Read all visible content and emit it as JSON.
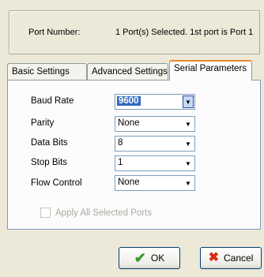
{
  "port": {
    "label": "Port Number:",
    "value": "1 Port(s) Selected. 1st port is Port 1"
  },
  "tabs": [
    {
      "label": "Basic Settings",
      "active": false
    },
    {
      "label": "Advanced Settings",
      "active": false
    },
    {
      "label": "Serial Parameters",
      "active": true
    }
  ],
  "fields": [
    {
      "label": "Baud Rate",
      "value": "9600",
      "icon": "chevron-down-icon"
    },
    {
      "label": "Parity",
      "value": "None",
      "icon": "chevron-down-icon"
    },
    {
      "label": "Data Bits",
      "value": "8",
      "icon": "chevron-down-icon"
    },
    {
      "label": "Stop Bits",
      "value": "1",
      "icon": "chevron-down-icon"
    },
    {
      "label": "Flow Control",
      "value": "None",
      "icon": "chevron-down-icon"
    }
  ],
  "apply_all": {
    "label": "Apply All Selected Ports",
    "checked": false,
    "enabled": false
  },
  "buttons": {
    "ok_label": "OK",
    "ok_icon": "check-icon",
    "cancel_label": "Cancel",
    "cancel_icon": "x-icon"
  },
  "colors": {
    "selection": "#316ac5",
    "active_tab_accent": "#e68b2c"
  }
}
